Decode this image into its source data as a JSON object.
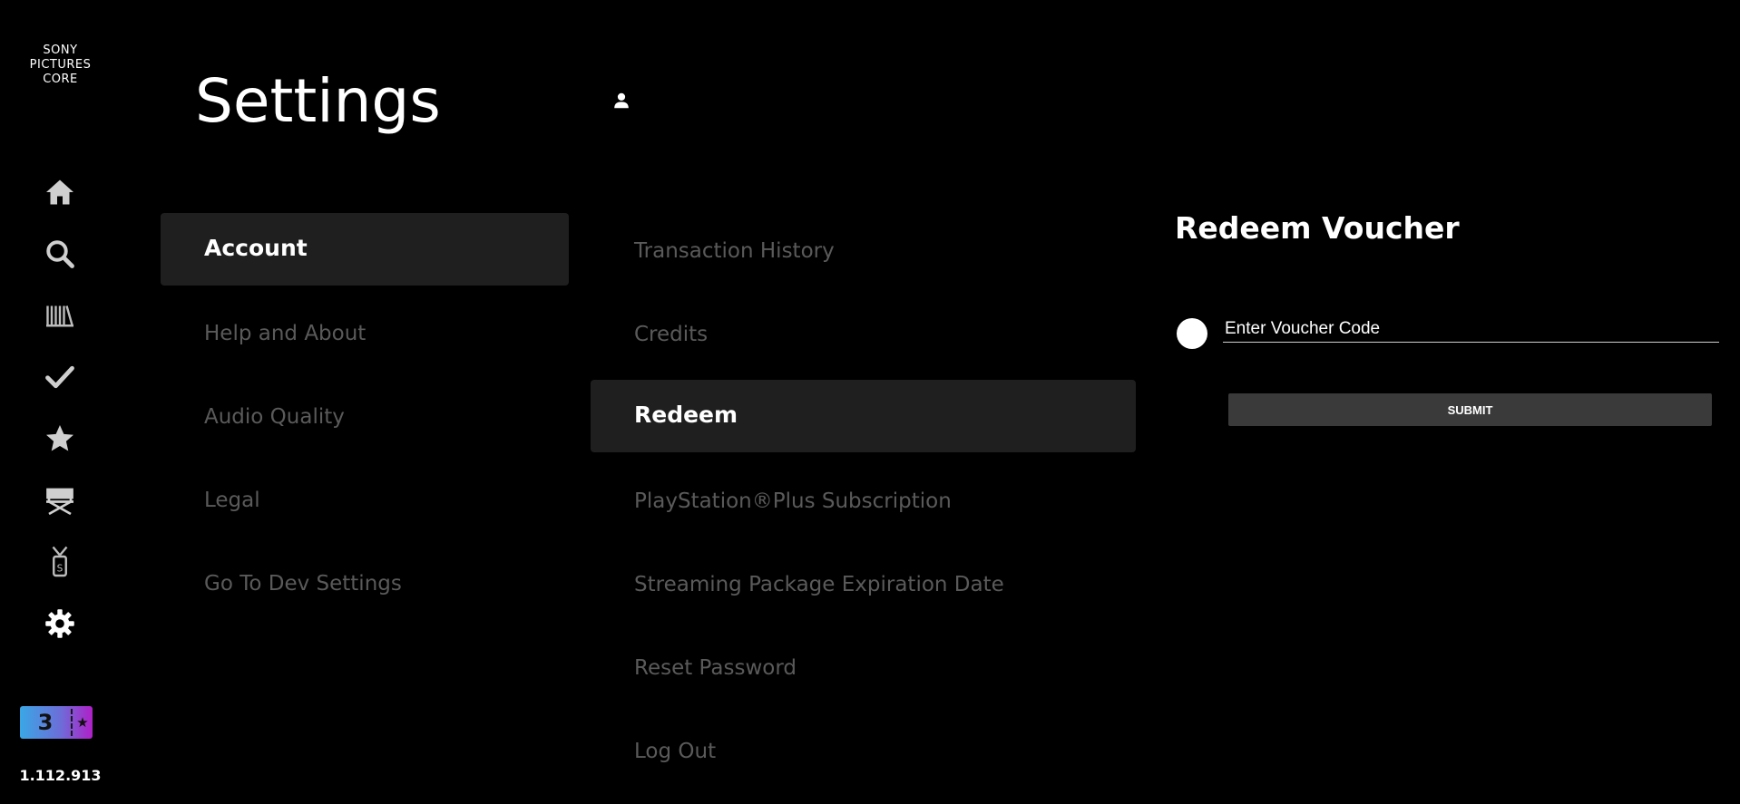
{
  "sidebar": {
    "logo_lines": [
      "SONY",
      "PICTURES",
      "CORE"
    ],
    "nav": [
      {
        "icon": "home-icon"
      },
      {
        "icon": "search-icon"
      },
      {
        "icon": "library-icon"
      },
      {
        "icon": "checkmark-icon"
      },
      {
        "icon": "star-icon"
      },
      {
        "icon": "director-chair-icon"
      },
      {
        "icon": "ticket-pass-icon"
      },
      {
        "icon": "gear-icon",
        "active": true
      }
    ],
    "badge": {
      "number": "3",
      "star": "★"
    },
    "version": "1.112.913"
  },
  "header": {
    "title": "Settings",
    "user_icon": "user-icon"
  },
  "categories": [
    {
      "label": "Account",
      "active": true
    },
    {
      "label": "Help and About"
    },
    {
      "label": "Audio Quality"
    },
    {
      "label": "Legal"
    },
    {
      "label": "Go To Dev Settings"
    }
  ],
  "submenu": [
    {
      "label": "Transaction History"
    },
    {
      "label": "Credits"
    },
    {
      "label": "Redeem",
      "active": true
    },
    {
      "label": "PlayStation®Plus Subscription"
    },
    {
      "label": "Streaming Package Expiration Date"
    },
    {
      "label": "Reset Password"
    },
    {
      "label": "Log Out"
    }
  ],
  "redeem": {
    "title": "Redeem Voucher",
    "input_placeholder": "Enter Voucher Code",
    "input_value": "",
    "submit_label": "SUBMIT"
  },
  "colors": {
    "background": "#000000",
    "active_item_bg": "#1f1f1f",
    "inactive_text": "#5a5a5a",
    "submit_bg": "#3a3a3a"
  }
}
